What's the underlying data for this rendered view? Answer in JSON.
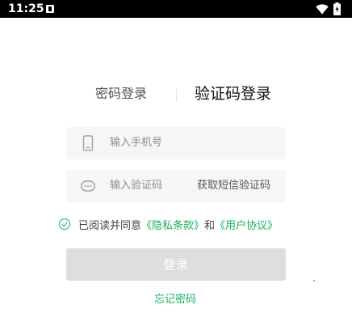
{
  "status_bar": {
    "time": "11:25",
    "icons": [
      "notification-icon",
      "wifi-icon",
      "battery-icon"
    ]
  },
  "tabs": {
    "password_login": "密码登录",
    "code_login": "验证码登录"
  },
  "phone_input": {
    "placeholder": "输入手机号",
    "value": "",
    "icon": "phone-icon"
  },
  "code_input": {
    "placeholder": "输入验证码",
    "value": "",
    "icon": "message-icon",
    "get_code_label": "获取短信验证码"
  },
  "agreement": {
    "prefix": "已阅读并同意",
    "privacy_link": "《隐私条款》",
    "and": "和",
    "user_link": "《用户协议》",
    "checked": true
  },
  "login_button": {
    "label": "登录"
  },
  "forgot_password": {
    "label": "忘记密码"
  },
  "colors": {
    "accent": "#1aaf5d",
    "button_disabled": "#dedede",
    "input_bg": "#f6f6f6"
  }
}
